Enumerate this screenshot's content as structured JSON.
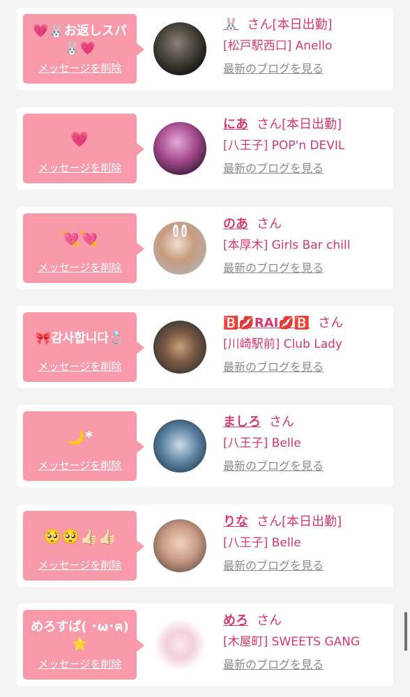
{
  "items": [
    {
      "message": "💗🐰お返しスパ🐰💗",
      "message_is_emoji": false,
      "delete_label": "メッセージを削除",
      "name": "🐰",
      "suffix": "さん[本日出勤]",
      "shop": "[松戸駅西口] Anello",
      "blog_label": "最新のブログを見る"
    },
    {
      "message": "💗",
      "message_is_emoji": true,
      "delete_label": "メッセージを削除",
      "name": "にあ",
      "suffix": "さん[本日出勤]",
      "shop": "[八王子] POP'n DEVIL",
      "blog_label": "最新のブログを見る"
    },
    {
      "message": "💘💘",
      "message_is_emoji": true,
      "delete_label": "メッセージを削除",
      "name": "のあ",
      "suffix": "さん",
      "shop": "[本厚木] Girls Bar chill",
      "blog_label": "最新のブログを見る"
    },
    {
      "message": "🎀감사합니다💍",
      "message_is_emoji": false,
      "delete_label": "メッセージを削除",
      "name": "🅱️💋RAI💋🅱️",
      "suffix": "さん",
      "shop": "[川崎駅前] Club Lady",
      "blog_label": "最新のブログを見る"
    },
    {
      "message": "🌙*",
      "message_is_emoji": true,
      "delete_label": "メッセージを削除",
      "name": "ましろ",
      "suffix": "さん",
      "shop": "[八王子] Belle",
      "blog_label": "最新のブログを見る"
    },
    {
      "message": "🥺🥺👍🏻👍🏻",
      "message_is_emoji": true,
      "delete_label": "メッセージを削除",
      "name": "りな",
      "suffix": "さん[本日出勤]",
      "shop": "[八王子] Belle",
      "blog_label": "最新のブログを見る"
    },
    {
      "message": "めろすぱ( ･ω･ฅ)⭐️",
      "message_is_emoji": false,
      "delete_label": "メッセージを削除",
      "name": "めろ",
      "suffix": "さん",
      "shop": "[木屋町] SWEETS GANG",
      "blog_label": "最新のブログを見る"
    }
  ],
  "colors": {
    "page_background": "#f3f3f3",
    "bubble": "#f89aa9",
    "accent_text": "#d8396a",
    "link_gray": "#8a8a8a"
  }
}
